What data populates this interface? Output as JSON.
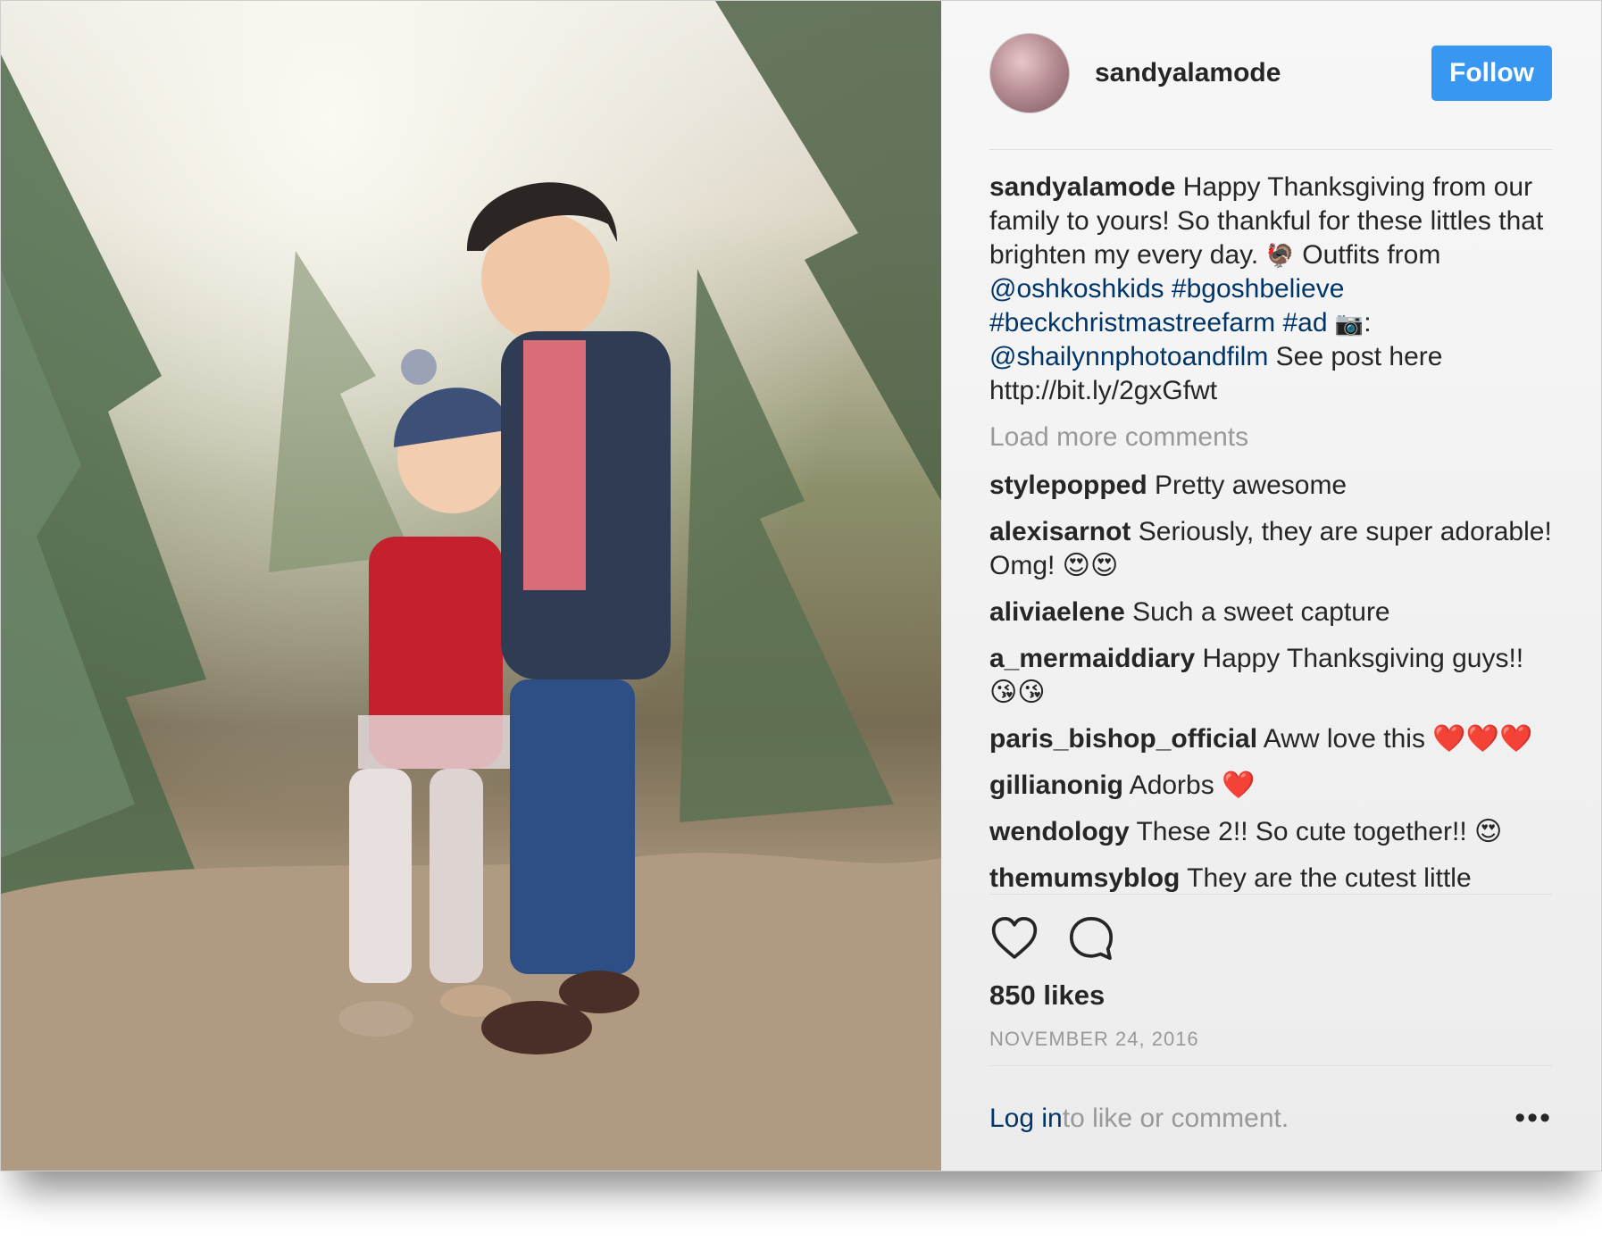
{
  "profile": {
    "username": "sandyalamode",
    "follow_label": "Follow"
  },
  "caption": {
    "username": "sandyalamode",
    "text1": " Happy Thanksgiving from our family to yours! So thankful for these littles that brighten my every day. ",
    "emoji1": "🦃",
    "text2": " Outfits from ",
    "mention1": "@oshkoshkids",
    "text3": " ",
    "hashtag1": "#bgoshbelieve",
    "text4": " ",
    "hashtag2": "#beckchristmastreefarm",
    "text5": " ",
    "hashtag3": "#ad",
    "text6": " ",
    "emoji2": "📷",
    "text7": ": ",
    "mention2": "@shailynnphotoandfilm",
    "text8": " See post here http://bit.ly/2gxGfwt"
  },
  "load_more": "Load more comments",
  "comments": [
    {
      "username": "stylepopped",
      "text": " Pretty awesome"
    },
    {
      "username": "alexisarnot",
      "text": " Seriously, they are super adorable! Omg! 😍😍"
    },
    {
      "username": "aliviaelene",
      "text": " Such a sweet capture"
    },
    {
      "username": "a_mermaiddiary",
      "text": " Happy Thanksgiving guys!! 😘😘"
    },
    {
      "username": "paris_bishop_official",
      "text": " Aww love this ❤️❤️❤️"
    },
    {
      "username": "gillianonig",
      "text": " Adorbs ❤️"
    },
    {
      "username": "wendology",
      "text": " These 2!! So cute together!! 😍"
    },
    {
      "username": "themumsyblog",
      "text": " They are the cutest little"
    }
  ],
  "actions": {
    "like_icon": "heart-icon",
    "comment_icon": "comment-bubble-icon"
  },
  "likes": "850 likes",
  "date": "NOVEMBER 24, 2016",
  "footer": {
    "login": "Log in",
    "rest": " to like or comment.",
    "more": "•••"
  }
}
